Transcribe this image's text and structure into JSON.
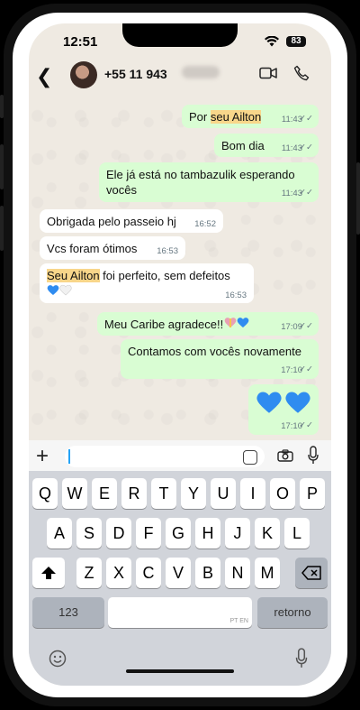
{
  "status_bar": {
    "time": "12:51",
    "battery": "83"
  },
  "header": {
    "contact": "+55 11 943"
  },
  "messages": [
    {
      "dir": "out",
      "parts": [
        {
          "t": "Por ",
          "hl": false
        },
        {
          "t": "seu Ailton",
          "hl": true
        }
      ],
      "time": "11:43"
    },
    {
      "dir": "out",
      "parts": [
        {
          "t": "Bom dia",
          "hl": false
        }
      ],
      "time": "11:43"
    },
    {
      "dir": "out",
      "parts": [
        {
          "t": "Ele já está no tambazulik esperando vocês",
          "hl": false
        }
      ],
      "time": "11:43"
    },
    {
      "dir": "in",
      "parts": [
        {
          "t": "Obrigada pelo passeio hj",
          "hl": false
        }
      ],
      "time": "16:52"
    },
    {
      "dir": "in",
      "parts": [
        {
          "t": "Vcs foram ótimos",
          "hl": false
        }
      ],
      "time": "16:53"
    },
    {
      "dir": "in",
      "parts": [
        {
          "t": "Seu Ailton",
          "hl": true
        },
        {
          "t": " foi perfeito, sem defeitos",
          "hl": false
        }
      ],
      "time": "16:53"
    },
    {
      "dir": "out",
      "parts": [
        {
          "t": "Meu Caribe agradece!!",
          "hl": false
        }
      ],
      "time": "17:09"
    },
    {
      "dir": "out",
      "parts": [
        {
          "t": "Contamos com vocês novamente",
          "hl": false
        }
      ],
      "time": "17:10"
    },
    {
      "dir": "out",
      "parts": [],
      "time": "17:10"
    }
  ],
  "keyboard": {
    "row1": [
      "Q",
      "W",
      "E",
      "R",
      "T",
      "Y",
      "U",
      "I",
      "O",
      "P"
    ],
    "row2": [
      "A",
      "S",
      "D",
      "F",
      "G",
      "H",
      "J",
      "K",
      "L"
    ],
    "row3": [
      "Z",
      "X",
      "C",
      "V",
      "B",
      "N",
      "M"
    ],
    "numbers_key": "123",
    "space_lang": "PT EN",
    "return_key": "retorno"
  },
  "colors": {
    "outgoing_bubble": "#d9fdd3",
    "incoming_bubble": "#ffffff",
    "highlight": "#f8d68a",
    "heart_blue": "#2f8cf0"
  }
}
